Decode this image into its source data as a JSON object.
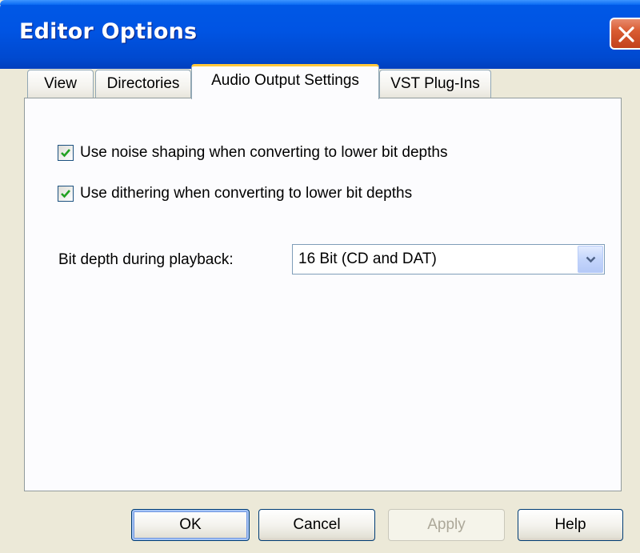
{
  "window": {
    "title": "Editor Options"
  },
  "tabs": [
    {
      "label": "View"
    },
    {
      "label": "Directories"
    },
    {
      "label": "Audio Output Settings"
    },
    {
      "label": "VST Plug-Ins"
    }
  ],
  "active_tab": "Audio Output Settings",
  "audio_output": {
    "noise_shaping": {
      "label": "Use noise shaping when converting to lower bit depths",
      "checked": true
    },
    "dithering": {
      "label": "Use dithering when converting to lower bit depths",
      "checked": true
    },
    "bit_depth": {
      "label": "Bit depth during playback:",
      "value": "16 Bit (CD and DAT)"
    }
  },
  "buttons": {
    "ok": "OK",
    "cancel": "Cancel",
    "apply": "Apply",
    "help": "Help"
  },
  "colors": {
    "titlebar": "#0054e3",
    "check": "#21a121",
    "close": "#d95c32"
  }
}
